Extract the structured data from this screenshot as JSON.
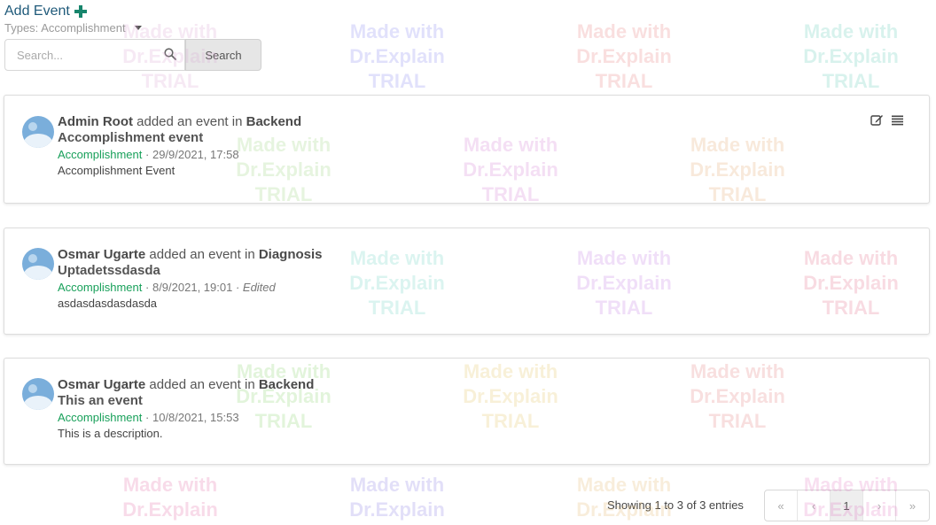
{
  "toolbar": {
    "add_event_label": "Add Event",
    "types_filter": "Types: Accomplishment",
    "search_placeholder": "Search...",
    "search_button_label": "Search"
  },
  "events": [
    {
      "author": "Admin Root",
      "action": "added an event in",
      "category": "Backend",
      "title": "Accomplishment event",
      "type": "Accomplishment",
      "separator": "·",
      "datetime": "29/9/2021, 17:58",
      "edited": "",
      "description": "Accomplishment Event"
    },
    {
      "author": "Osmar Ugarte",
      "action": "added an event in",
      "category": "Diagnosis",
      "title": "Uptadetssdasda",
      "type": "Accomplishment",
      "separator": "·",
      "datetime": "8/9/2021, 19:01",
      "edited": "· Edited",
      "description": "asdasdasdasdasda"
    },
    {
      "author": "Osmar Ugarte",
      "action": "added an event in",
      "category": "Backend",
      "title": "This an event",
      "type": "Accomplishment",
      "separator": "·",
      "datetime": "10/8/2021, 15:53",
      "edited": "",
      "description": "This is a description."
    }
  ],
  "footer": {
    "showing_text": "Showing 1 to 3 of 3 entries",
    "pagination": {
      "first": "«",
      "prev": "‹",
      "current_page": "1",
      "next": "›",
      "last": "»"
    }
  },
  "watermark": {
    "line1": "Made with",
    "line2": "Dr.Explain",
    "line3": "TRIAL"
  },
  "icons": {
    "add": "plus-icon",
    "search": "search-icon",
    "dropdown": "caret-down-icon",
    "edit": "edit-icon",
    "menu": "list-icon",
    "avatar": "avatar-icon"
  },
  "colors": {
    "add_event_text": "#1f5a7a",
    "add_icon": "#17856c",
    "event_type": "#18a05a"
  }
}
